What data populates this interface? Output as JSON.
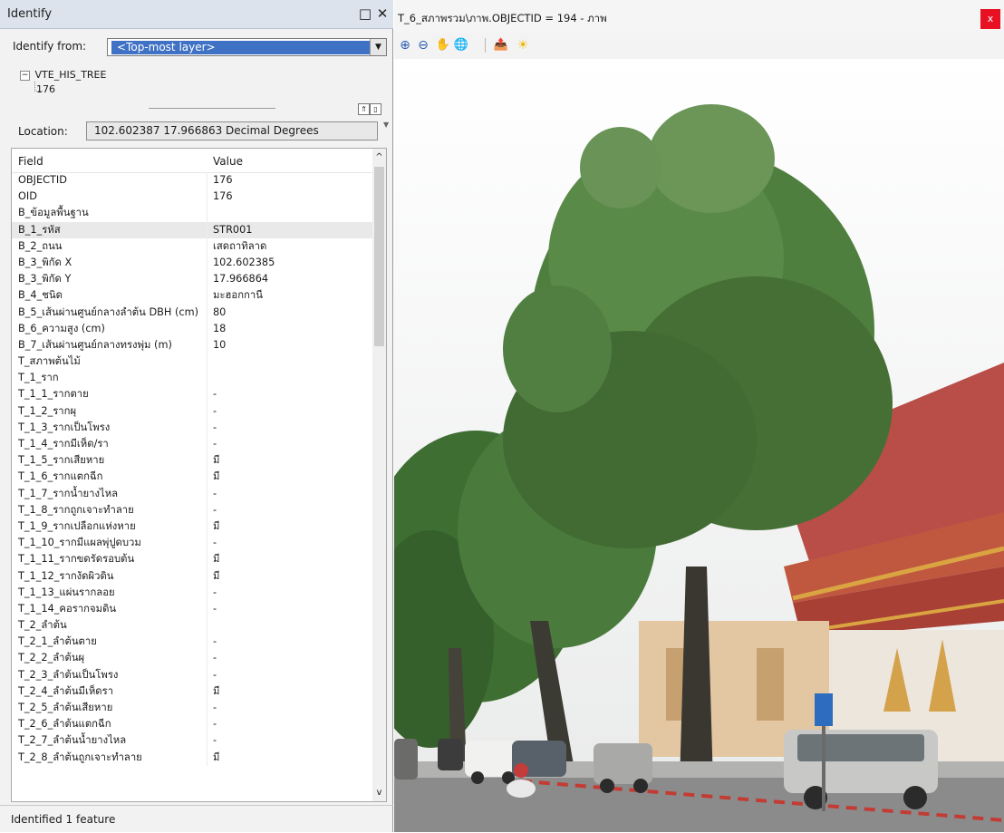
{
  "identify": {
    "title": "Identify",
    "restore_glyph": "□",
    "close_glyph": "✕",
    "from_label": "Identify from:",
    "from_value": "<Top-most layer>",
    "tree": {
      "layer": "VTE_HIS_TREE",
      "feature": "176",
      "expand_glyph": "⊟"
    },
    "location_label": "Location:",
    "location_value": "102.602387  17.966863 Decimal Degrees",
    "columns": {
      "field": "Field",
      "value": "Value"
    },
    "rows": [
      {
        "field": "OBJECTID",
        "value": "176"
      },
      {
        "field": "OID",
        "value": "176"
      },
      {
        "field": "B_ข้อมูลพื้นฐาน",
        "value": ""
      },
      {
        "field": "B_1_รหัส",
        "value": "STR001",
        "selected": true
      },
      {
        "field": "B_2_ถนน",
        "value": "เสดถาทิลาด"
      },
      {
        "field": "B_3_พิกัด X",
        "value": "102.602385"
      },
      {
        "field": "B_3_พิกัด Y",
        "value": "17.966864"
      },
      {
        "field": "B_4_ชนิด",
        "value": "มะฮอกกานี"
      },
      {
        "field": "B_5_เส้นผ่านศูนย์กลางลำต้น DBH (cm)",
        "value": "80"
      },
      {
        "field": "B_6_ความสูง (cm)",
        "value": "18"
      },
      {
        "field": "B_7_เส้นผ่านศูนย์กลางทรงพุ่ม (m)",
        "value": "10"
      },
      {
        "field": "T_สภาพต้นไม้",
        "value": ""
      },
      {
        "field": "T_1_ราก",
        "value": ""
      },
      {
        "field": "T_1_1_รากตาย",
        "value": "-"
      },
      {
        "field": "T_1_2_รากผุ",
        "value": "-"
      },
      {
        "field": "T_1_3_รากเป็นโพรง",
        "value": "-"
      },
      {
        "field": "T_1_4_รากมีเห็ด/รา",
        "value": "-"
      },
      {
        "field": "T_1_5_รากเสียหาย",
        "value": "มี"
      },
      {
        "field": "T_1_6_รากแตกฉีก",
        "value": "มี"
      },
      {
        "field": "T_1_7_รากน้ำยางไหล",
        "value": "-"
      },
      {
        "field": "T_1_8_รากถูกเจาะทำลาย",
        "value": "-"
      },
      {
        "field": "T_1_9_รากเปลือกแห่งหาย",
        "value": "มี"
      },
      {
        "field": "T_1_10_รากมีแผลพุ่ปูดบวม",
        "value": "-"
      },
      {
        "field": "T_1_11_รากขดรัดรอบต้น",
        "value": "มี"
      },
      {
        "field": "T_1_12_รากงัดผิวดิน",
        "value": "มี"
      },
      {
        "field": "T_1_13_แผ่นรากลอย",
        "value": "-"
      },
      {
        "field": "T_1_14_คอรากจมดิน",
        "value": "-"
      },
      {
        "field": "T_2_ลำต้น",
        "value": ""
      },
      {
        "field": "T_2_1_ลำต้นตาย",
        "value": "-"
      },
      {
        "field": "T_2_2_ลำต้นผุ",
        "value": "-"
      },
      {
        "field": "T_2_3_ลำต้นเป็นโพรง",
        "value": "-"
      },
      {
        "field": "T_2_4_ลำต้นมีเห็ดรา",
        "value": "มี"
      },
      {
        "field": "T_2_5_ลำต้นเสียหาย",
        "value": "-"
      },
      {
        "field": "T_2_6_ลำต้นแตกฉีก",
        "value": "-"
      },
      {
        "field": "T_2_7_ลำต้นน้ำยางไหล",
        "value": "-"
      },
      {
        "field": "T_2_8_ลำต้นถูกเจาะทำลาย",
        "value": "มี"
      }
    ],
    "status": "Identified 1 feature"
  },
  "viewer": {
    "title": "T_6_สภาพรวม\\ภาพ.OBJECTID = 194 - ภาพ",
    "close_glyph": "x",
    "toolbar": [
      {
        "name": "zoom-in-icon",
        "glyph": "⊕"
      },
      {
        "name": "zoom-out-icon",
        "glyph": "⊖"
      },
      {
        "name": "pan-hand-icon",
        "glyph": "✋"
      },
      {
        "name": "globe-icon",
        "glyph": "🌐"
      },
      {
        "name": "export-icon",
        "glyph": "📤"
      },
      {
        "name": "brightness-icon",
        "glyph": "☀"
      }
    ]
  }
}
